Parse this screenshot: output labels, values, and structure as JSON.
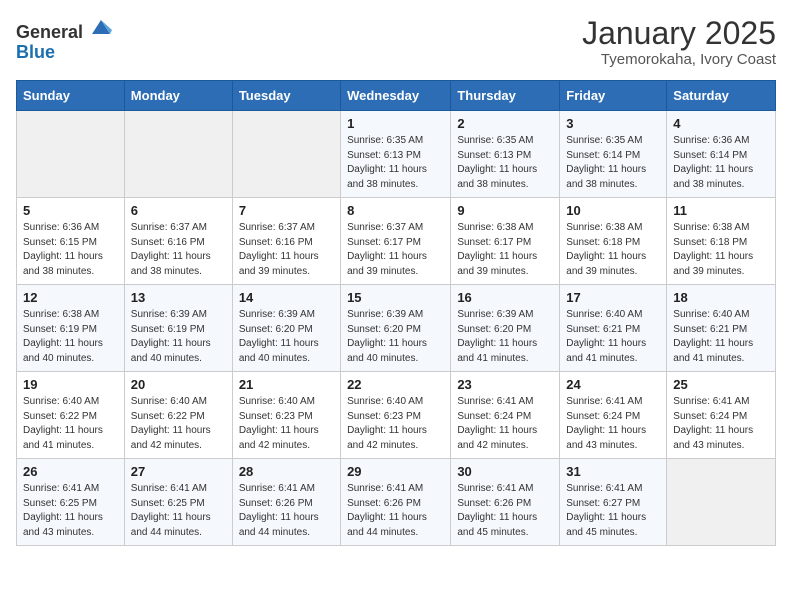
{
  "header": {
    "logo_general": "General",
    "logo_blue": "Blue",
    "month": "January 2025",
    "location": "Tyemorokaha, Ivory Coast"
  },
  "weekdays": [
    "Sunday",
    "Monday",
    "Tuesday",
    "Wednesday",
    "Thursday",
    "Friday",
    "Saturday"
  ],
  "weeks": [
    [
      {
        "day": "",
        "sunrise": "",
        "sunset": "",
        "daylight": ""
      },
      {
        "day": "",
        "sunrise": "",
        "sunset": "",
        "daylight": ""
      },
      {
        "day": "",
        "sunrise": "",
        "sunset": "",
        "daylight": ""
      },
      {
        "day": "1",
        "sunrise": "Sunrise: 6:35 AM",
        "sunset": "Sunset: 6:13 PM",
        "daylight": "Daylight: 11 hours and 38 minutes."
      },
      {
        "day": "2",
        "sunrise": "Sunrise: 6:35 AM",
        "sunset": "Sunset: 6:13 PM",
        "daylight": "Daylight: 11 hours and 38 minutes."
      },
      {
        "day": "3",
        "sunrise": "Sunrise: 6:35 AM",
        "sunset": "Sunset: 6:14 PM",
        "daylight": "Daylight: 11 hours and 38 minutes."
      },
      {
        "day": "4",
        "sunrise": "Sunrise: 6:36 AM",
        "sunset": "Sunset: 6:14 PM",
        "daylight": "Daylight: 11 hours and 38 minutes."
      }
    ],
    [
      {
        "day": "5",
        "sunrise": "Sunrise: 6:36 AM",
        "sunset": "Sunset: 6:15 PM",
        "daylight": "Daylight: 11 hours and 38 minutes."
      },
      {
        "day": "6",
        "sunrise": "Sunrise: 6:37 AM",
        "sunset": "Sunset: 6:16 PM",
        "daylight": "Daylight: 11 hours and 38 minutes."
      },
      {
        "day": "7",
        "sunrise": "Sunrise: 6:37 AM",
        "sunset": "Sunset: 6:16 PM",
        "daylight": "Daylight: 11 hours and 39 minutes."
      },
      {
        "day": "8",
        "sunrise": "Sunrise: 6:37 AM",
        "sunset": "Sunset: 6:17 PM",
        "daylight": "Daylight: 11 hours and 39 minutes."
      },
      {
        "day": "9",
        "sunrise": "Sunrise: 6:38 AM",
        "sunset": "Sunset: 6:17 PM",
        "daylight": "Daylight: 11 hours and 39 minutes."
      },
      {
        "day": "10",
        "sunrise": "Sunrise: 6:38 AM",
        "sunset": "Sunset: 6:18 PM",
        "daylight": "Daylight: 11 hours and 39 minutes."
      },
      {
        "day": "11",
        "sunrise": "Sunrise: 6:38 AM",
        "sunset": "Sunset: 6:18 PM",
        "daylight": "Daylight: 11 hours and 39 minutes."
      }
    ],
    [
      {
        "day": "12",
        "sunrise": "Sunrise: 6:38 AM",
        "sunset": "Sunset: 6:19 PM",
        "daylight": "Daylight: 11 hours and 40 minutes."
      },
      {
        "day": "13",
        "sunrise": "Sunrise: 6:39 AM",
        "sunset": "Sunset: 6:19 PM",
        "daylight": "Daylight: 11 hours and 40 minutes."
      },
      {
        "day": "14",
        "sunrise": "Sunrise: 6:39 AM",
        "sunset": "Sunset: 6:20 PM",
        "daylight": "Daylight: 11 hours and 40 minutes."
      },
      {
        "day": "15",
        "sunrise": "Sunrise: 6:39 AM",
        "sunset": "Sunset: 6:20 PM",
        "daylight": "Daylight: 11 hours and 40 minutes."
      },
      {
        "day": "16",
        "sunrise": "Sunrise: 6:39 AM",
        "sunset": "Sunset: 6:20 PM",
        "daylight": "Daylight: 11 hours and 41 minutes."
      },
      {
        "day": "17",
        "sunrise": "Sunrise: 6:40 AM",
        "sunset": "Sunset: 6:21 PM",
        "daylight": "Daylight: 11 hours and 41 minutes."
      },
      {
        "day": "18",
        "sunrise": "Sunrise: 6:40 AM",
        "sunset": "Sunset: 6:21 PM",
        "daylight": "Daylight: 11 hours and 41 minutes."
      }
    ],
    [
      {
        "day": "19",
        "sunrise": "Sunrise: 6:40 AM",
        "sunset": "Sunset: 6:22 PM",
        "daylight": "Daylight: 11 hours and 41 minutes."
      },
      {
        "day": "20",
        "sunrise": "Sunrise: 6:40 AM",
        "sunset": "Sunset: 6:22 PM",
        "daylight": "Daylight: 11 hours and 42 minutes."
      },
      {
        "day": "21",
        "sunrise": "Sunrise: 6:40 AM",
        "sunset": "Sunset: 6:23 PM",
        "daylight": "Daylight: 11 hours and 42 minutes."
      },
      {
        "day": "22",
        "sunrise": "Sunrise: 6:40 AM",
        "sunset": "Sunset: 6:23 PM",
        "daylight": "Daylight: 11 hours and 42 minutes."
      },
      {
        "day": "23",
        "sunrise": "Sunrise: 6:41 AM",
        "sunset": "Sunset: 6:24 PM",
        "daylight": "Daylight: 11 hours and 42 minutes."
      },
      {
        "day": "24",
        "sunrise": "Sunrise: 6:41 AM",
        "sunset": "Sunset: 6:24 PM",
        "daylight": "Daylight: 11 hours and 43 minutes."
      },
      {
        "day": "25",
        "sunrise": "Sunrise: 6:41 AM",
        "sunset": "Sunset: 6:24 PM",
        "daylight": "Daylight: 11 hours and 43 minutes."
      }
    ],
    [
      {
        "day": "26",
        "sunrise": "Sunrise: 6:41 AM",
        "sunset": "Sunset: 6:25 PM",
        "daylight": "Daylight: 11 hours and 43 minutes."
      },
      {
        "day": "27",
        "sunrise": "Sunrise: 6:41 AM",
        "sunset": "Sunset: 6:25 PM",
        "daylight": "Daylight: 11 hours and 44 minutes."
      },
      {
        "day": "28",
        "sunrise": "Sunrise: 6:41 AM",
        "sunset": "Sunset: 6:26 PM",
        "daylight": "Daylight: 11 hours and 44 minutes."
      },
      {
        "day": "29",
        "sunrise": "Sunrise: 6:41 AM",
        "sunset": "Sunset: 6:26 PM",
        "daylight": "Daylight: 11 hours and 44 minutes."
      },
      {
        "day": "30",
        "sunrise": "Sunrise: 6:41 AM",
        "sunset": "Sunset: 6:26 PM",
        "daylight": "Daylight: 11 hours and 45 minutes."
      },
      {
        "day": "31",
        "sunrise": "Sunrise: 6:41 AM",
        "sunset": "Sunset: 6:27 PM",
        "daylight": "Daylight: 11 hours and 45 minutes."
      },
      {
        "day": "",
        "sunrise": "",
        "sunset": "",
        "daylight": ""
      }
    ]
  ]
}
